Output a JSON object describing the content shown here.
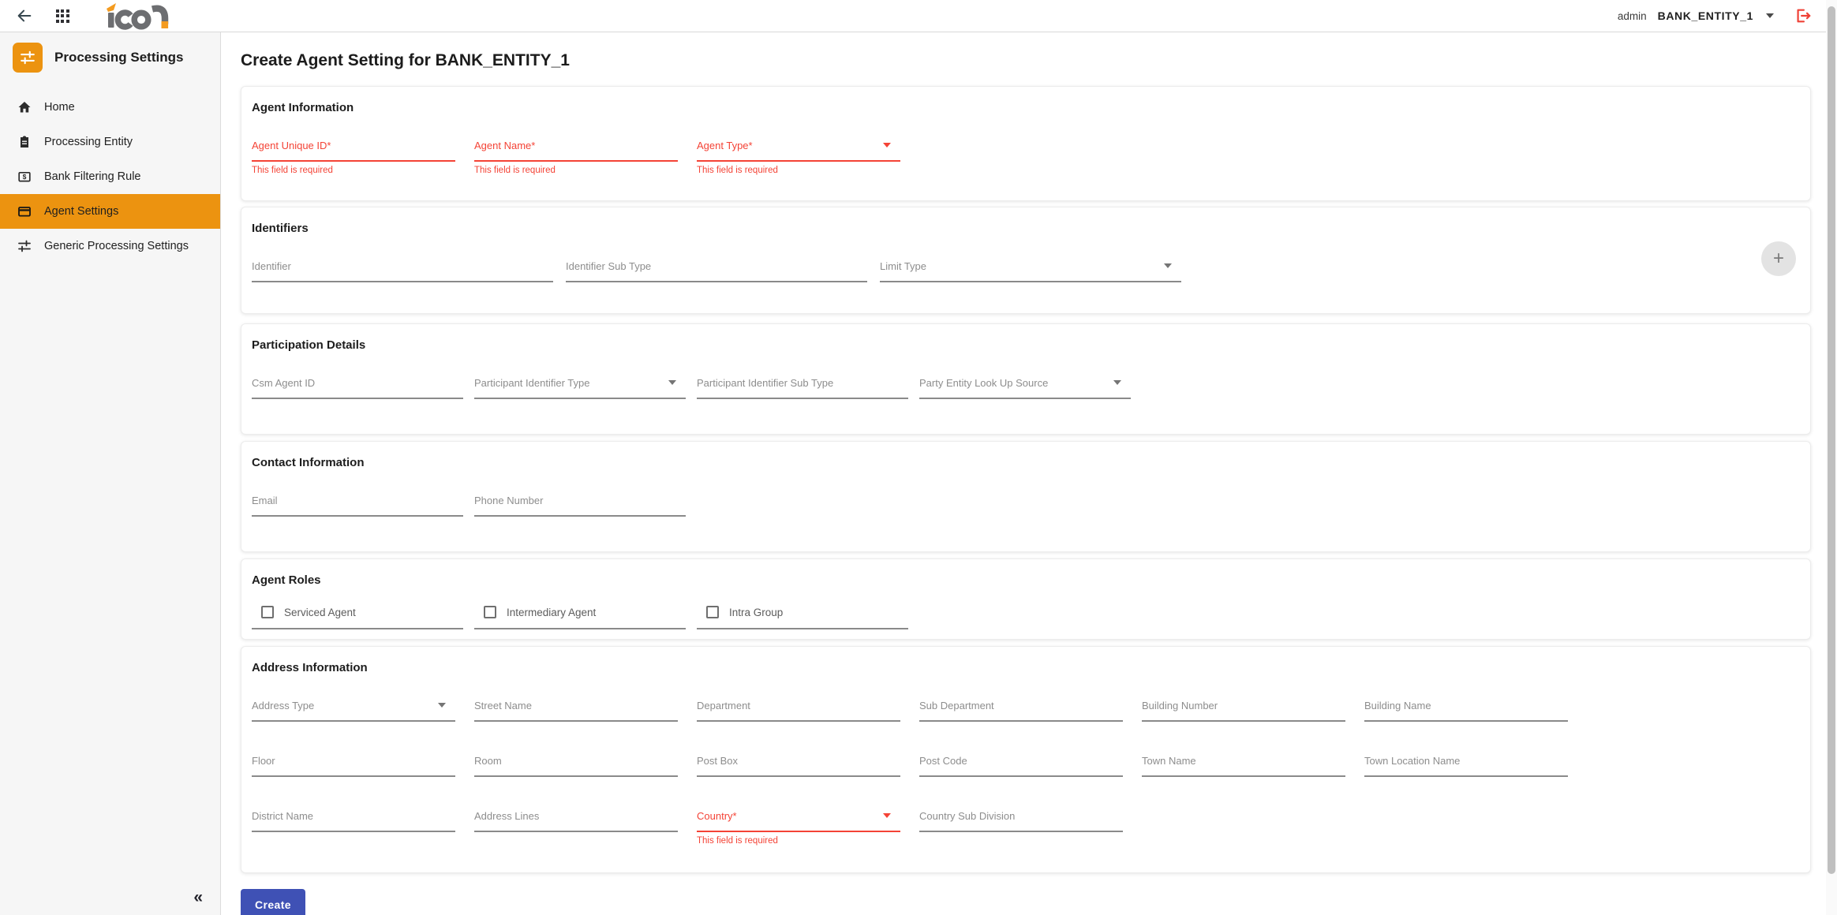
{
  "topbar": {
    "user_label": "admin",
    "entity_label": "BANK_ENTITY_1"
  },
  "sidebar": {
    "title": "Processing Settings",
    "items": [
      {
        "label": "Home"
      },
      {
        "label": "Processing Entity"
      },
      {
        "label": "Bank Filtering Rule"
      },
      {
        "label": "Agent Settings"
      },
      {
        "label": "Generic Processing Settings"
      }
    ],
    "collapse_glyph": "«"
  },
  "page": {
    "title": "Create Agent Setting for BANK_ENTITY_1"
  },
  "sections": [
    {
      "title": "Agent Information",
      "fields": [
        {
          "label": "Agent Unique ID*",
          "error": "This field is required"
        },
        {
          "label": "Agent Name*",
          "error": "This field is required"
        },
        {
          "label": "Agent Type*",
          "error": "This field is required"
        }
      ]
    },
    {
      "title": "Identifiers",
      "add_label": "+",
      "fields": [
        {
          "label": "Identifier"
        },
        {
          "label": "Identifier Sub Type"
        },
        {
          "label": "Limit Type"
        }
      ]
    },
    {
      "title": "Participation Details",
      "fields": [
        {
          "label": "Csm Agent ID"
        },
        {
          "label": "Participant Identifier Type"
        },
        {
          "label": "Participant Identifier Sub Type"
        },
        {
          "label": "Party Entity Look Up Source"
        }
      ]
    },
    {
      "title": "Contact Information",
      "fields": [
        {
          "label": "Email"
        },
        {
          "label": "Phone Number"
        }
      ]
    },
    {
      "title": "Agent Roles",
      "checkboxes": [
        {
          "label": "Serviced Agent"
        },
        {
          "label": "Intermediary Agent"
        },
        {
          "label": "Intra Group"
        }
      ]
    },
    {
      "title": "Address Information",
      "rows": [
        [
          {
            "label": "Address Type"
          },
          {
            "label": "Street Name"
          },
          {
            "label": "Department"
          },
          {
            "label": "Sub Department"
          },
          {
            "label": "Building Number"
          },
          {
            "label": "Building Name"
          }
        ],
        [
          {
            "label": "Floor"
          },
          {
            "label": "Room"
          },
          {
            "label": "Post Box"
          },
          {
            "label": "Post Code"
          },
          {
            "label": "Town Name"
          },
          {
            "label": "Town Location Name"
          }
        ],
        [
          {
            "label": "District Name"
          },
          {
            "label": "Address Lines"
          },
          {
            "label": "Country*",
            "error": "This field is required"
          },
          {
            "label": "Country Sub Division"
          }
        ]
      ]
    }
  ],
  "actions": {
    "create_label": "Create"
  },
  "colors": {
    "accent_orange": "#EC9310",
    "error_red": "#F44336",
    "primary_indigo": "#3F51B5"
  }
}
